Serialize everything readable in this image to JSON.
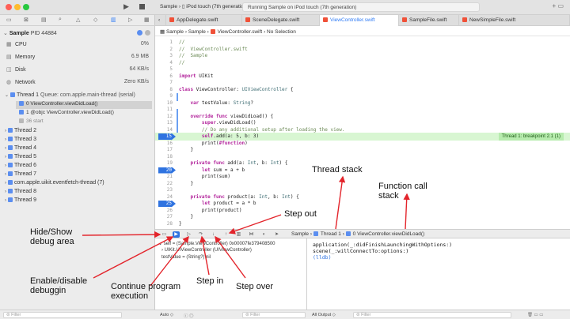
{
  "left": {
    "process": {
      "name": "Sample",
      "pid_label": "PID 44884"
    },
    "gauges": [
      {
        "icon": "cpu-icon",
        "glyph": "▦",
        "label": "CPU",
        "value": "0%"
      },
      {
        "icon": "memory-icon",
        "glyph": "▤",
        "label": "Memory",
        "value": "6.9 MB"
      },
      {
        "icon": "disk-icon",
        "glyph": "◫",
        "label": "Disk",
        "value": "64 KB/s"
      },
      {
        "icon": "network-icon",
        "glyph": "◍",
        "label": "Network",
        "value": "Zero KB/s"
      }
    ],
    "thread1": {
      "label": "Thread 1",
      "queue": "Queue: com.apple.main-thread (serial)"
    },
    "frames": [
      {
        "label": "0 ViewController.viewDidLoad()"
      },
      {
        "label": "1 @objc ViewController.viewDidLoad()"
      },
      {
        "label": "36 start"
      }
    ],
    "threads": [
      "Thread 2",
      "Thread 3",
      "Thread 4",
      "Thread 5",
      "Thread 6",
      "Thread 7",
      "com.apple.uikit.eventfetch-thread (7)",
      "Thread 8",
      "Thread 9"
    ],
    "filter_placeholder": "Filter"
  },
  "toolbar": {
    "scheme": "Sample",
    "device": "iPod touch (7th generation)",
    "status": "Running Sample on iPod touch (7th generation)"
  },
  "tabs": [
    "AppDelegate.swift",
    "SceneDelegate.swift",
    "ViewController.swift",
    "SampleFile.swift",
    "NewSimpleFile.swift"
  ],
  "jumpbar": {
    "project": "Sample",
    "folder": "Sample",
    "file": "ViewController.swift",
    "selection": "No Selection"
  },
  "code": [
    {
      "n": "1",
      "segs": [
        [
          "cm",
          "//"
        ]
      ]
    },
    {
      "n": "2",
      "segs": [
        [
          "cm",
          "//  ViewController.swift"
        ]
      ]
    },
    {
      "n": "3",
      "segs": [
        [
          "cm",
          "//  Sample"
        ]
      ]
    },
    {
      "n": "4",
      "segs": [
        [
          "cm",
          "//"
        ]
      ]
    },
    {
      "n": "5",
      "segs": []
    },
    {
      "n": "6",
      "segs": [
        [
          "kw",
          "import"
        ],
        [
          "pl",
          " UIKit"
        ]
      ]
    },
    {
      "n": "7",
      "segs": []
    },
    {
      "n": "8",
      "segs": [
        [
          "kw",
          "class"
        ],
        [
          "pl",
          " ViewController: "
        ],
        [
          "ty",
          "UIViewController"
        ],
        [
          "pl",
          " {"
        ]
      ]
    },
    {
      "n": "9",
      "segs": []
    },
    {
      "n": "10",
      "segs": [
        [
          "pl",
          "    "
        ],
        [
          "kw",
          "var"
        ],
        [
          "pl",
          " testValue: "
        ],
        [
          "ty",
          "String"
        ],
        [
          "pl",
          "?"
        ]
      ]
    },
    {
      "n": "11",
      "segs": []
    },
    {
      "n": "12",
      "segs": [
        [
          "pl",
          "    "
        ],
        [
          "kw",
          "override func"
        ],
        [
          "pl",
          " viewDidLoad() {"
        ]
      ]
    },
    {
      "n": "13",
      "segs": [
        [
          "pl",
          "        "
        ],
        [
          "kw",
          "super"
        ],
        [
          "pl",
          ".viewDidLoad()"
        ]
      ]
    },
    {
      "n": "14",
      "segs": [
        [
          "cm",
          "        // Do any additional setup after loading the view."
        ]
      ]
    },
    {
      "n": "15",
      "segs": [
        [
          "pl",
          "        "
        ],
        [
          "kw",
          "self"
        ],
        [
          "pl",
          ".add(a: 5, b: 3)"
        ]
      ]
    },
    {
      "n": "16",
      "segs": [
        [
          "pl",
          "        print("
        ],
        [
          "kw",
          "#function"
        ],
        [
          "pl",
          ")"
        ]
      ]
    },
    {
      "n": "17",
      "segs": [
        [
          "pl",
          "    }"
        ]
      ]
    },
    {
      "n": "18",
      "segs": []
    },
    {
      "n": "19",
      "segs": [
        [
          "pl",
          "    "
        ],
        [
          "kw",
          "private func"
        ],
        [
          "pl",
          " add(a: "
        ],
        [
          "ty",
          "Int"
        ],
        [
          "pl",
          ", b: "
        ],
        [
          "ty",
          "Int"
        ],
        [
          "pl",
          ") {"
        ]
      ]
    },
    {
      "n": "20",
      "segs": [
        [
          "pl",
          "        "
        ],
        [
          "kw",
          "let"
        ],
        [
          "pl",
          " sum = a + b"
        ]
      ]
    },
    {
      "n": "21",
      "segs": [
        [
          "pl",
          "        print(sum)"
        ]
      ]
    },
    {
      "n": "22",
      "segs": [
        [
          "pl",
          "    }"
        ]
      ]
    },
    {
      "n": "23",
      "segs": []
    },
    {
      "n": "24",
      "segs": [
        [
          "pl",
          "    "
        ],
        [
          "kw",
          "private func"
        ],
        [
          "pl",
          " product(a: "
        ],
        [
          "ty",
          "Int"
        ],
        [
          "pl",
          ", b: "
        ],
        [
          "ty",
          "Int"
        ],
        [
          "pl",
          ") {"
        ]
      ]
    },
    {
      "n": "25",
      "segs": [
        [
          "pl",
          "        "
        ],
        [
          "kw",
          "let"
        ],
        [
          "pl",
          " product = a * b"
        ]
      ]
    },
    {
      "n": "26",
      "segs": [
        [
          "pl",
          "        print(product)"
        ]
      ]
    },
    {
      "n": "27",
      "segs": [
        [
          "pl",
          "    }"
        ]
      ]
    },
    {
      "n": "28",
      "segs": [
        [
          "pl",
          "}"
        ]
      ]
    }
  ],
  "breakpoint_label": "Thread 1: breakpoint 2.1 (1)",
  "debugbar": {
    "project": "Sample",
    "thread": "Thread 1",
    "frame": "0 ViewController.viewDidLoad()"
  },
  "variables": [
    "self = (Sample.ViewController) 0x00007fe379408500",
    "UIKit.UIViewController (UIViewController)",
    "testValue = (String?) nil"
  ],
  "console": [
    "application(_:didFinishLaunchingWithOptions:)",
    "scene(_:willConnectTo:options:)",
    "(lldb)"
  ],
  "bottombar": {
    "auto": "Auto ◇",
    "filter": "Filter",
    "all_output": "All Output ◇"
  },
  "annotations": {
    "hide_show": "Hide/Show\ndebug area",
    "enable_disable": "Enable/disable\ndebuggin",
    "continue": "Continue program\nexecution",
    "step_in": "Step in",
    "step_over": "Step over",
    "step_out": "Step out",
    "thread_stack": "Thread stack",
    "function_call": "Function call\nstack"
  },
  "colors": {
    "accent": "#2f73e0",
    "breakpoint": "#2f73e0",
    "highlight": "#d8f6d2",
    "arrow": "#e3242b"
  }
}
